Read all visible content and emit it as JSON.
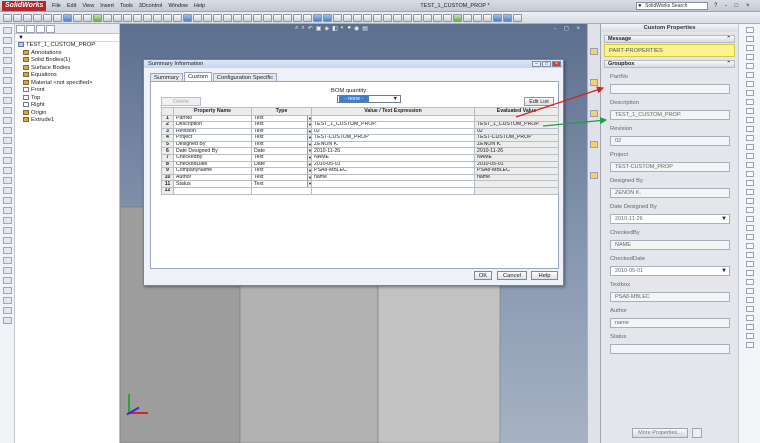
{
  "app": {
    "logo": "SolidWorks",
    "menu": [
      "File",
      "Edit",
      "View",
      "Insert",
      "Tools",
      "3Dcontrol",
      "Window",
      "Help"
    ],
    "document_title": "TEST_1_CUSTOM_PROP *",
    "search_placeholder": "SolidWorks Search",
    "help_controls": "? - □ ×"
  },
  "tree": {
    "filter": "▼",
    "items": [
      {
        "label": "TEST_1_CUSTOM_PROP",
        "icon": "part-icon",
        "indent": 0
      },
      {
        "label": "Annotations",
        "icon": "annotation-icon",
        "indent": 1
      },
      {
        "label": "Solid Bodies(1)",
        "icon": "folder-icon",
        "indent": 1
      },
      {
        "label": "Surface Bodies",
        "icon": "folder-icon",
        "indent": 1
      },
      {
        "label": "Equations",
        "icon": "equations-icon",
        "indent": 1
      },
      {
        "label": "Material <not specified>",
        "icon": "material-icon",
        "indent": 1
      },
      {
        "label": "Front",
        "icon": "plane-icon",
        "indent": 1
      },
      {
        "label": "Top",
        "icon": "plane-icon",
        "indent": 1
      },
      {
        "label": "Right",
        "icon": "plane-icon",
        "indent": 1
      },
      {
        "label": "Origin",
        "icon": "origin-icon",
        "indent": 1
      },
      {
        "label": "Extrude1",
        "icon": "extrude-icon",
        "indent": 1
      }
    ]
  },
  "dialog": {
    "title": "Summary Information",
    "tabs": [
      "Summary",
      "Custom",
      "Configuration Specific"
    ],
    "active_tab": "Custom",
    "delete_label": "Delete",
    "bom_label": "BOM quantity:",
    "bom_value": "- none -",
    "edit_list_label": "Edit List",
    "columns": [
      "",
      "Property Name",
      "Type",
      "Value / Text Expression",
      "Evaluated Value"
    ],
    "rows": [
      {
        "num": "1",
        "name": "PartNo",
        "type": "Text",
        "value": "",
        "evaluated": ""
      },
      {
        "num": "2",
        "name": "Description",
        "type": "Text",
        "value": "TEST_1_CUSTOM_PROP.",
        "evaluated": "TEST_1_CUSTOM_PROP."
      },
      {
        "num": "3",
        "name": "Revision",
        "type": "Text",
        "value": "02",
        "evaluated": "02"
      },
      {
        "num": "4",
        "name": "Project",
        "type": "Text",
        "value": "TEST-CUSTOM_PROP",
        "evaluated": "TEST-CUSTOM_PROP"
      },
      {
        "num": "5",
        "name": "Designed By",
        "type": "Text",
        "value": "ZENON K.",
        "evaluated": "ZENON K."
      },
      {
        "num": "6",
        "name": "Date Designed By",
        "type": "Date",
        "value": "2010-11-26",
        "evaluated": "2010-11-26"
      },
      {
        "num": "7",
        "name": "CheckedBy",
        "type": "Text",
        "value": "NAME",
        "evaluated": "NAME"
      },
      {
        "num": "8",
        "name": "CheckedDate",
        "type": "Date",
        "value": "2010-05-01",
        "evaluated": "2010-05-01"
      },
      {
        "num": "9",
        "name": "CompanyName",
        "type": "Text",
        "value": "PSA8-MBLEC",
        "evaluated": "PSA8-MBLEC"
      },
      {
        "num": "10",
        "name": "Author",
        "type": "Text",
        "value": "name",
        "evaluated": "name"
      },
      {
        "num": "11",
        "name": "Status",
        "type": "Text",
        "value": "",
        "evaluated": ""
      },
      {
        "num": "12",
        "name": "",
        "type": "",
        "value": "",
        "evaluated": ""
      }
    ],
    "ok_label": "OK",
    "cancel_label": "Cancel",
    "help_label": "Help"
  },
  "custom_properties": {
    "title": "Custom Properties",
    "message_header": "Message",
    "message": "PART-PROPERTIES",
    "groupbox_header": "Groupbox",
    "fields": [
      {
        "label": "PartNo",
        "value": "",
        "dropdown": false
      },
      {
        "label": "Description",
        "value": "TEST_1_CUSTOM_PROP.",
        "dropdown": false
      },
      {
        "label": "Revision",
        "value": "02",
        "dropdown": false
      },
      {
        "label": "Project",
        "value": "TEST-CUSTOM_PROP",
        "dropdown": false
      },
      {
        "label": "Designed By",
        "value": "ZENON K.",
        "dropdown": false
      },
      {
        "label": "Date Designed By",
        "value": "2010-11-26",
        "dropdown": true
      },
      {
        "label": "CheckedBy",
        "value": "NAME",
        "dropdown": false
      },
      {
        "label": "CheckedDate",
        "value": "2010-05-01",
        "dropdown": true
      },
      {
        "label": "Textbox",
        "value": "PSA8-MBLEC",
        "dropdown": false
      },
      {
        "label": "Author",
        "value": "name",
        "dropdown": false
      },
      {
        "label": "Status",
        "value": "",
        "dropdown": false
      }
    ],
    "more_properties_label": "More Properties..."
  },
  "colors": {
    "arrow_red": "#d42222",
    "arrow_green": "#1f9e44",
    "message_bg": "#fbf48c",
    "part_face_front": "#c2c2c2",
    "part_face_side": "#9d9d9d"
  }
}
